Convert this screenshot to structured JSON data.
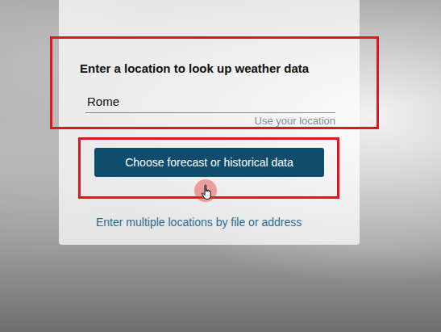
{
  "form": {
    "title": "Enter a location to look up weather data",
    "value": "Rome",
    "use_location": "Use your location",
    "highlighted": true
  },
  "button": {
    "label": "Choose forecast or historical data",
    "highlighted": true,
    "cursor": true
  },
  "link": "Enter multiple locations by file or address"
}
